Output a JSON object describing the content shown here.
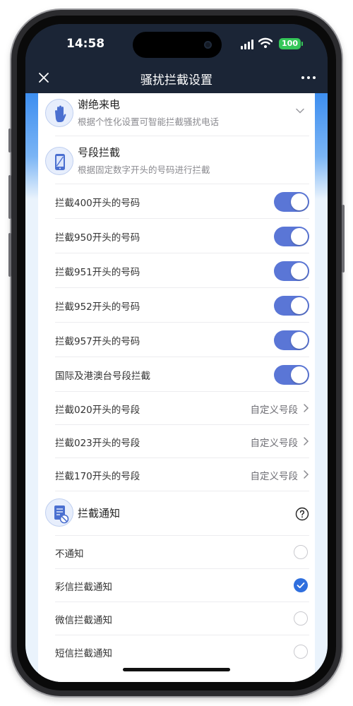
{
  "status_bar": {
    "time": "14:58",
    "battery": "100"
  },
  "nav": {
    "title": "骚扰拦截设置",
    "close_icon": "close-icon",
    "more_icon": "more-icon"
  },
  "features": {
    "reject_calls": {
      "title": "谢绝来电",
      "subtitle": "根据个性化设置可智能拦截骚扰电话",
      "icon": "hand-icon"
    },
    "number_block": {
      "title": "号段拦截",
      "subtitle": "根据固定数字开头的号码进行拦截",
      "icon": "phone-icon"
    }
  },
  "toggles": [
    {
      "label": "拦截400开头的号码",
      "on": true
    },
    {
      "label": "拦截950开头的号码",
      "on": true
    },
    {
      "label": "拦截951开头的号码",
      "on": true
    },
    {
      "label": "拦截952开头的号码",
      "on": true
    },
    {
      "label": "拦截957开头的号码",
      "on": true
    },
    {
      "label": "国际及港澳台号段拦截",
      "on": true
    }
  ],
  "custom_segments": [
    {
      "label": "拦截020开头的号段",
      "value": "自定义号段"
    },
    {
      "label": "拦截023开头的号段",
      "value": "自定义号段"
    },
    {
      "label": "拦截170开头的号段",
      "value": "自定义号段"
    }
  ],
  "notify": {
    "title": "拦截通知",
    "icon": "document-block-icon",
    "options": [
      {
        "label": "不通知",
        "checked": false
      },
      {
        "label": "彩信拦截通知",
        "checked": true
      },
      {
        "label": "微信拦截通知",
        "checked": false
      },
      {
        "label": "短信拦截通知",
        "checked": false
      }
    ]
  },
  "colors": {
    "toggle_on": "#5a76d6",
    "radio_checked": "#2f6fde",
    "header_bg": "#1b2536",
    "accent_blue": "#3d8ef0"
  }
}
